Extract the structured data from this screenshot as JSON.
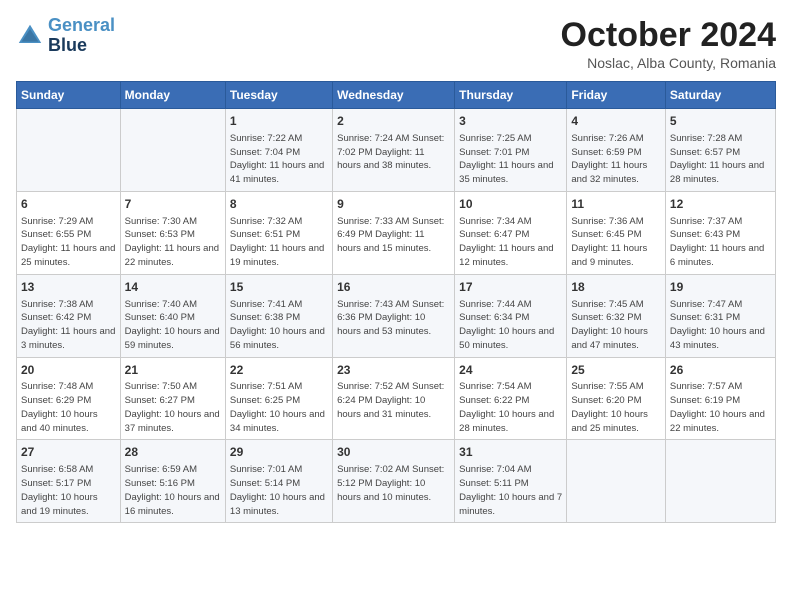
{
  "header": {
    "logo_line1": "General",
    "logo_line2": "Blue",
    "month": "October 2024",
    "location": "Noslac, Alba County, Romania"
  },
  "days_of_week": [
    "Sunday",
    "Monday",
    "Tuesday",
    "Wednesday",
    "Thursday",
    "Friday",
    "Saturday"
  ],
  "weeks": [
    [
      {
        "day": "",
        "text": ""
      },
      {
        "day": "",
        "text": ""
      },
      {
        "day": "1",
        "text": "Sunrise: 7:22 AM\nSunset: 7:04 PM\nDaylight: 11 hours and 41 minutes."
      },
      {
        "day": "2",
        "text": "Sunrise: 7:24 AM\nSunset: 7:02 PM\nDaylight: 11 hours and 38 minutes."
      },
      {
        "day": "3",
        "text": "Sunrise: 7:25 AM\nSunset: 7:01 PM\nDaylight: 11 hours and 35 minutes."
      },
      {
        "day": "4",
        "text": "Sunrise: 7:26 AM\nSunset: 6:59 PM\nDaylight: 11 hours and 32 minutes."
      },
      {
        "day": "5",
        "text": "Sunrise: 7:28 AM\nSunset: 6:57 PM\nDaylight: 11 hours and 28 minutes."
      }
    ],
    [
      {
        "day": "6",
        "text": "Sunrise: 7:29 AM\nSunset: 6:55 PM\nDaylight: 11 hours and 25 minutes."
      },
      {
        "day": "7",
        "text": "Sunrise: 7:30 AM\nSunset: 6:53 PM\nDaylight: 11 hours and 22 minutes."
      },
      {
        "day": "8",
        "text": "Sunrise: 7:32 AM\nSunset: 6:51 PM\nDaylight: 11 hours and 19 minutes."
      },
      {
        "day": "9",
        "text": "Sunrise: 7:33 AM\nSunset: 6:49 PM\nDaylight: 11 hours and 15 minutes."
      },
      {
        "day": "10",
        "text": "Sunrise: 7:34 AM\nSunset: 6:47 PM\nDaylight: 11 hours and 12 minutes."
      },
      {
        "day": "11",
        "text": "Sunrise: 7:36 AM\nSunset: 6:45 PM\nDaylight: 11 hours and 9 minutes."
      },
      {
        "day": "12",
        "text": "Sunrise: 7:37 AM\nSunset: 6:43 PM\nDaylight: 11 hours and 6 minutes."
      }
    ],
    [
      {
        "day": "13",
        "text": "Sunrise: 7:38 AM\nSunset: 6:42 PM\nDaylight: 11 hours and 3 minutes."
      },
      {
        "day": "14",
        "text": "Sunrise: 7:40 AM\nSunset: 6:40 PM\nDaylight: 10 hours and 59 minutes."
      },
      {
        "day": "15",
        "text": "Sunrise: 7:41 AM\nSunset: 6:38 PM\nDaylight: 10 hours and 56 minutes."
      },
      {
        "day": "16",
        "text": "Sunrise: 7:43 AM\nSunset: 6:36 PM\nDaylight: 10 hours and 53 minutes."
      },
      {
        "day": "17",
        "text": "Sunrise: 7:44 AM\nSunset: 6:34 PM\nDaylight: 10 hours and 50 minutes."
      },
      {
        "day": "18",
        "text": "Sunrise: 7:45 AM\nSunset: 6:32 PM\nDaylight: 10 hours and 47 minutes."
      },
      {
        "day": "19",
        "text": "Sunrise: 7:47 AM\nSunset: 6:31 PM\nDaylight: 10 hours and 43 minutes."
      }
    ],
    [
      {
        "day": "20",
        "text": "Sunrise: 7:48 AM\nSunset: 6:29 PM\nDaylight: 10 hours and 40 minutes."
      },
      {
        "day": "21",
        "text": "Sunrise: 7:50 AM\nSunset: 6:27 PM\nDaylight: 10 hours and 37 minutes."
      },
      {
        "day": "22",
        "text": "Sunrise: 7:51 AM\nSunset: 6:25 PM\nDaylight: 10 hours and 34 minutes."
      },
      {
        "day": "23",
        "text": "Sunrise: 7:52 AM\nSunset: 6:24 PM\nDaylight: 10 hours and 31 minutes."
      },
      {
        "day": "24",
        "text": "Sunrise: 7:54 AM\nSunset: 6:22 PM\nDaylight: 10 hours and 28 minutes."
      },
      {
        "day": "25",
        "text": "Sunrise: 7:55 AM\nSunset: 6:20 PM\nDaylight: 10 hours and 25 minutes."
      },
      {
        "day": "26",
        "text": "Sunrise: 7:57 AM\nSunset: 6:19 PM\nDaylight: 10 hours and 22 minutes."
      }
    ],
    [
      {
        "day": "27",
        "text": "Sunrise: 6:58 AM\nSunset: 5:17 PM\nDaylight: 10 hours and 19 minutes."
      },
      {
        "day": "28",
        "text": "Sunrise: 6:59 AM\nSunset: 5:16 PM\nDaylight: 10 hours and 16 minutes."
      },
      {
        "day": "29",
        "text": "Sunrise: 7:01 AM\nSunset: 5:14 PM\nDaylight: 10 hours and 13 minutes."
      },
      {
        "day": "30",
        "text": "Sunrise: 7:02 AM\nSunset: 5:12 PM\nDaylight: 10 hours and 10 minutes."
      },
      {
        "day": "31",
        "text": "Sunrise: 7:04 AM\nSunset: 5:11 PM\nDaylight: 10 hours and 7 minutes."
      },
      {
        "day": "",
        "text": ""
      },
      {
        "day": "",
        "text": ""
      }
    ]
  ]
}
